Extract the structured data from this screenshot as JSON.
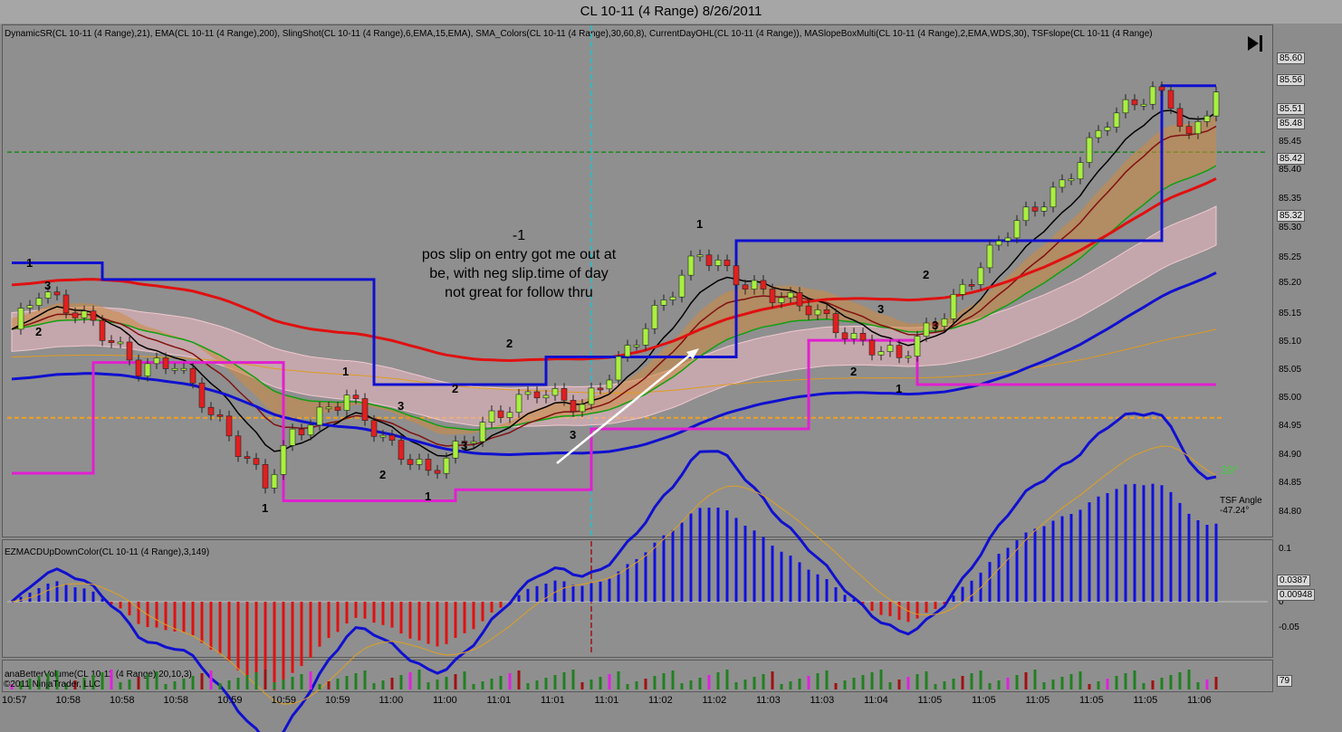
{
  "window": {
    "title": "CL 10-11 (4 Range)  8/26/2011"
  },
  "indicators": {
    "main": "DynamicSR(CL 10-11 (4 Range),21), EMA(CL 10-11 (4 Range),200), SlingShot(CL 10-11 (4 Range),6,EMA,15,EMA), SMA_Colors(CL 10-11 (4 Range),30,60,8), CurrentDayOHL(CL 10-11 (4 Range)), MASlopeBoxMulti(CL 10-11 (4 Range),2,EMA,WDS,30), TSFslope(CL 10-11 (4 Range)",
    "macd": "EZMACDUpDownColor(CL 10-11 (4 Range),3,149)",
    "volume": "anaBetterVolume(CL 10-11 (4 Range),20,10,3)"
  },
  "annotation": {
    "line1": "-1",
    "line2": "pos slip on entry got me out at",
    "line3": "be, with neg slip.time of day",
    "line4": "not great for follow thru"
  },
  "tsf": {
    "label": "TSF Angle",
    "value": "-47.24°",
    "angle": "39°"
  },
  "copyright": "©2011 NinjaTrader, LLC",
  "price_axis": {
    "ticks": [
      "85.25",
      "85.20",
      "85.15",
      "85.10",
      "85.05",
      "85.00",
      "84.95",
      "84.90",
      "84.85",
      "84.80",
      "85.45",
      "85.40",
      "85.35",
      "85.30"
    ],
    "boxes": [
      "85.60",
      "85.56",
      "85.51",
      "85.48",
      "85.42",
      "85.32"
    ]
  },
  "macd_axis": {
    "ticks": [
      "0.1",
      "0",
      "-0.05"
    ],
    "boxes": [
      "0.0387",
      "0.00948"
    ]
  },
  "volume_axis": {
    "box": "79"
  },
  "time_axis": [
    "10:57",
    "10:58",
    "10:58",
    "10:58",
    "10:59",
    "10:59",
    "10:59",
    "11:00",
    "11:00",
    "11:01",
    "11:01",
    "11:01",
    "11:02",
    "11:02",
    "11:03",
    "11:03",
    "11:04",
    "11:05",
    "11:05",
    "11:05",
    "11:05",
    "11:05",
    "11:06"
  ],
  "swing_labels": [
    {
      "t": "1",
      "x": 33,
      "y": 297
    },
    {
      "t": "3",
      "x": 53,
      "y": 322
    },
    {
      "t": "2",
      "x": 43,
      "y": 373
    },
    {
      "t": "1",
      "x": 293,
      "y": 568
    },
    {
      "t": "1",
      "x": 382,
      "y": 417
    },
    {
      "t": "2",
      "x": 423,
      "y": 531
    },
    {
      "t": "3",
      "x": 443,
      "y": 455
    },
    {
      "t": "1",
      "x": 473,
      "y": 555
    },
    {
      "t": "2",
      "x": 503,
      "y": 436
    },
    {
      "t": "3",
      "x": 513,
      "y": 499
    },
    {
      "t": "2",
      "x": 563,
      "y": 386
    },
    {
      "t": "3",
      "x": 633,
      "y": 487
    },
    {
      "t": "1",
      "x": 773,
      "y": 254
    },
    {
      "t": "3",
      "x": 973,
      "y": 348
    },
    {
      "t": "2",
      "x": 943,
      "y": 417
    },
    {
      "t": "1",
      "x": 993,
      "y": 436
    },
    {
      "t": "2",
      "x": 1023,
      "y": 310
    },
    {
      "t": "3",
      "x": 1033,
      "y": 366
    }
  ],
  "chart_data": {
    "type": "candlestick",
    "title": "CL 10-11 (4 Range)  8/26/2011",
    "ylim": [
      84.77,
      85.62
    ],
    "current_day_open": 84.96,
    "prior_level": 85.44,
    "series": [
      {
        "name": "DynamicSR resistance",
        "points": [
          [
            0,
            85.24
          ],
          [
            10,
            85.24
          ],
          [
            10,
            85.21
          ],
          [
            40,
            85.21
          ],
          [
            40,
            85.02
          ],
          [
            59,
            85.02
          ],
          [
            59,
            85.07
          ],
          [
            80,
            85.07
          ],
          [
            80,
            85.28
          ],
          [
            127,
            85.28
          ],
          [
            127,
            85.56
          ],
          [
            133,
            85.56
          ]
        ]
      },
      {
        "name": "DynamicSR support",
        "points": [
          [
            0,
            84.86
          ],
          [
            9,
            84.86
          ],
          [
            9,
            85.06
          ],
          [
            30,
            85.06
          ],
          [
            30,
            84.81
          ],
          [
            49,
            84.81
          ],
          [
            49,
            84.83
          ],
          [
            64,
            84.83
          ],
          [
            64,
            84.94
          ],
          [
            88,
            84.94
          ],
          [
            88,
            85.1
          ],
          [
            100,
            85.1
          ],
          [
            100,
            85.02
          ],
          [
            133,
            85.02
          ]
        ]
      }
    ]
  }
}
